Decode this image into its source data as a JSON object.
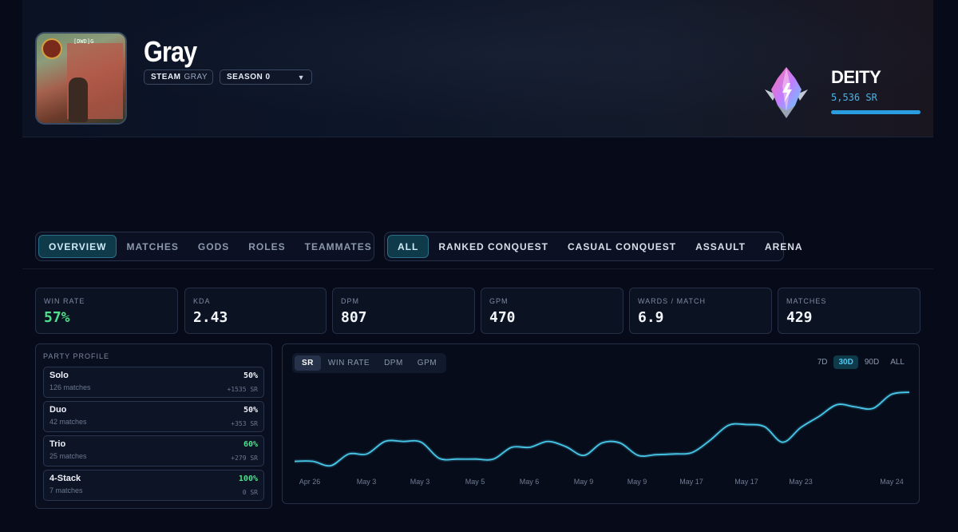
{
  "profile": {
    "name": "Gray",
    "platform": "STEAM",
    "platform_handle": "GRAY",
    "season": "SEASON 0",
    "avatar_tag": "[DWD]G"
  },
  "rank": {
    "tier": "DEITY",
    "sr": "5,536 SR",
    "progress_fraction": 1.0,
    "color": "#2a9de0"
  },
  "tabs": {
    "main": [
      "OVERVIEW",
      "MATCHES",
      "GODS",
      "ROLES",
      "TEAMMATES"
    ],
    "main_active": "OVERVIEW",
    "modes": [
      "ALL",
      "RANKED CONQUEST",
      "CASUAL CONQUEST",
      "ASSAULT",
      "ARENA"
    ],
    "mode_active": "ALL"
  },
  "stats": [
    {
      "label": "WIN RATE",
      "value": "57%",
      "good": true
    },
    {
      "label": "KDA",
      "value": "2.43"
    },
    {
      "label": "DPM",
      "value": "807"
    },
    {
      "label": "GPM",
      "value": "470"
    },
    {
      "label": "WARDS / MATCH",
      "value": "6.9"
    },
    {
      "label": "MATCHES",
      "value": "429"
    }
  ],
  "party": {
    "title": "PARTY PROFILE",
    "rows": [
      {
        "name": "Solo",
        "matches": "126 matches",
        "rate": "50%",
        "sr": "+1535 SR",
        "green": false
      },
      {
        "name": "Duo",
        "matches": "42 matches",
        "rate": "50%",
        "sr": "+353 SR",
        "green": false
      },
      {
        "name": "Trio",
        "matches": "25 matches",
        "rate": "60%",
        "sr": "+279 SR",
        "green": true
      },
      {
        "name": "4-Stack",
        "matches": "7 matches",
        "rate": "100%",
        "sr": "0 SR",
        "green": true
      }
    ]
  },
  "chart": {
    "metric_tabs": [
      "SR",
      "WIN RATE",
      "DPM",
      "GPM"
    ],
    "metric_active": "SR",
    "range_tabs": [
      "7D",
      "30D",
      "90D",
      "ALL"
    ],
    "range_active": "30D",
    "line_color": "#48c8ea"
  },
  "chart_data": {
    "type": "line",
    "x_tick_labels": [
      "Apr 26",
      "May 3",
      "May 3",
      "May 5",
      "May 6",
      "May 9",
      "May 9",
      "May 17",
      "May 17",
      "May 23",
      "May 24"
    ],
    "series": [
      {
        "values": [
          0.06,
          0.06,
          0.0,
          0.16,
          0.16,
          0.33,
          0.33,
          0.32,
          0.1,
          0.09,
          0.09,
          0.09,
          0.25,
          0.25,
          0.33,
          0.26,
          0.14,
          0.31,
          0.31,
          0.14,
          0.15,
          0.16,
          0.18,
          0.35,
          0.55,
          0.56,
          0.53,
          0.32,
          0.52,
          0.67,
          0.83,
          0.8,
          0.78,
          0.97,
          1.0
        ]
      }
    ],
    "y_axis": "SR (relative)",
    "grid": false,
    "legend": "none"
  }
}
